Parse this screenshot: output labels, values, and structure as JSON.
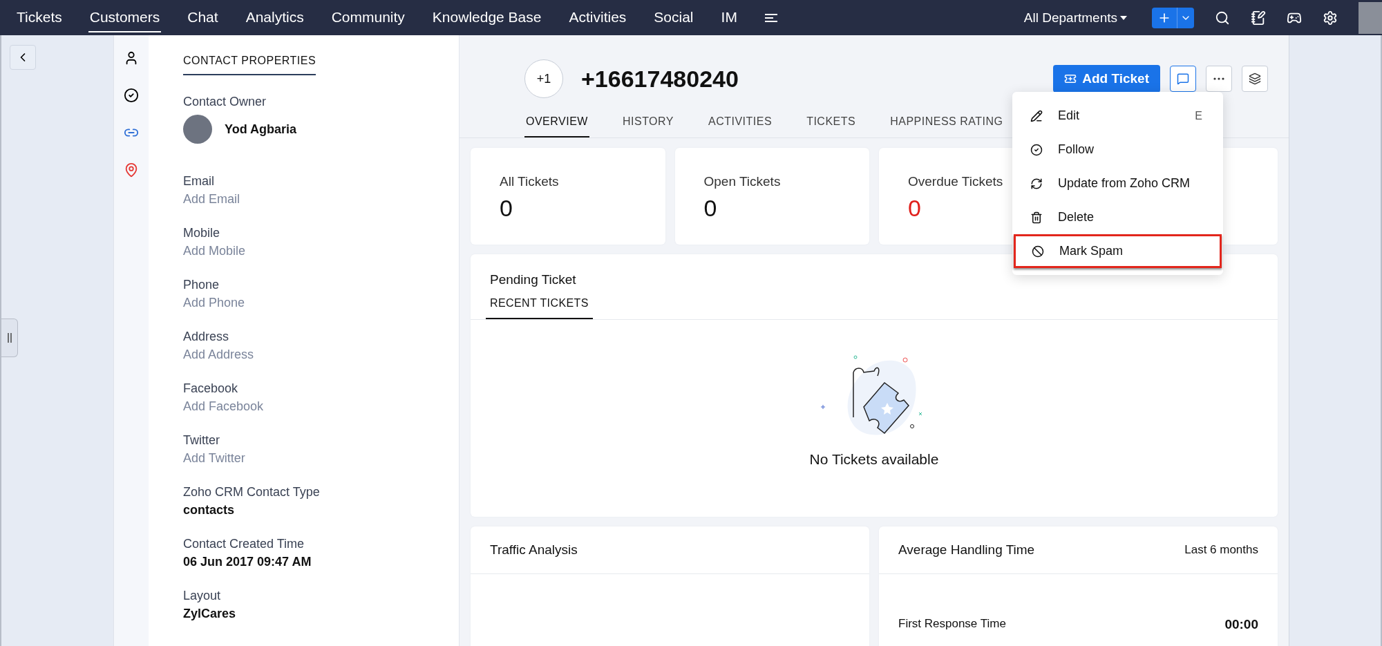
{
  "top_nav": {
    "items": [
      {
        "label": "Tickets",
        "selected": false
      },
      {
        "label": "Customers",
        "selected": true
      },
      {
        "label": "Chat",
        "selected": false
      },
      {
        "label": "Analytics",
        "selected": false
      },
      {
        "label": "Community",
        "selected": false
      },
      {
        "label": "Knowledge Base",
        "selected": false
      },
      {
        "label": "Activities",
        "selected": false
      },
      {
        "label": "Social",
        "selected": false
      },
      {
        "label": "IM",
        "selected": false
      }
    ],
    "department": "All Departments"
  },
  "properties": {
    "title": "CONTACT PROPERTIES",
    "owner_label": "Contact Owner",
    "owner_name": "Yod Agbaria",
    "fields": [
      {
        "label": "Email",
        "value": "Add Email",
        "empty": true
      },
      {
        "label": "Mobile",
        "value": "Add Mobile",
        "empty": true
      },
      {
        "label": "Phone",
        "value": "Add Phone",
        "empty": true
      },
      {
        "label": "Address",
        "value": "Add Address",
        "empty": true
      },
      {
        "label": "Facebook",
        "value": "Add Facebook",
        "empty": true
      },
      {
        "label": "Twitter",
        "value": "Add Twitter",
        "empty": true
      },
      {
        "label": "Zoho CRM Contact Type",
        "value": "contacts",
        "empty": false
      },
      {
        "label": "Contact Created Time",
        "value": "06 Jun 2017 09:47 AM",
        "empty": false
      },
      {
        "label": "Layout",
        "value": "ZylCares",
        "empty": false
      }
    ]
  },
  "contact": {
    "avatar_text": "+1",
    "name": "+16617480240",
    "add_ticket": "Add Ticket"
  },
  "tabs": [
    {
      "label": "OVERVIEW",
      "selected": true
    },
    {
      "label": "HISTORY",
      "selected": false
    },
    {
      "label": "ACTIVITIES",
      "selected": false
    },
    {
      "label": "TICKETS",
      "selected": false
    },
    {
      "label": "HAPPINESS RATING",
      "selected": false
    }
  ],
  "stats": [
    {
      "label": "All Tickets",
      "value": "0",
      "color": "#111111"
    },
    {
      "label": "Open Tickets",
      "value": "0",
      "color": "#111111"
    },
    {
      "label": "Overdue Tickets",
      "value": "0",
      "color": "#e0201c"
    }
  ],
  "pending": {
    "title": "Pending Ticket",
    "tab": "RECENT TICKETS",
    "empty_text": "No Tickets available"
  },
  "traffic": {
    "title": "Traffic Analysis"
  },
  "handling": {
    "title": "Average Handling Time",
    "period": "Last 6 months",
    "rows": [
      {
        "label": "First Response Time",
        "value": "00:00"
      }
    ]
  },
  "menu": [
    {
      "kind": "edit",
      "label": "Edit",
      "shortcut": "E",
      "highlighted": false
    },
    {
      "kind": "follow",
      "label": "Follow",
      "highlighted": false
    },
    {
      "kind": "update",
      "label": "Update from Zoho CRM",
      "highlighted": false
    },
    {
      "kind": "delete",
      "label": "Delete",
      "highlighted": false
    },
    {
      "kind": "spam",
      "label": "Mark Spam",
      "highlighted": true
    }
  ]
}
